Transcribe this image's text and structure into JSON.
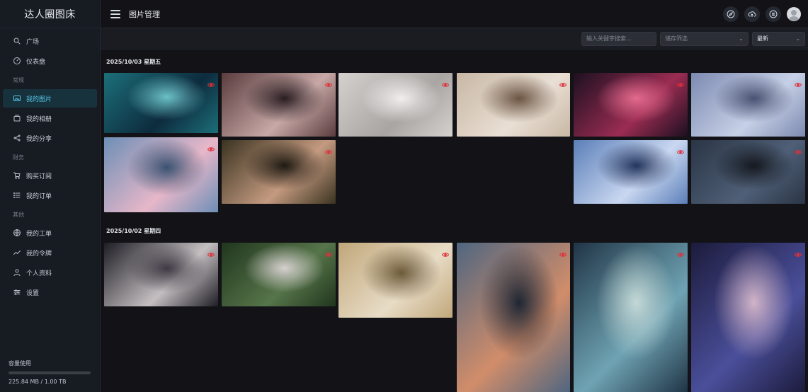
{
  "app": {
    "brand": "达人圈图床",
    "page_title": "图片管理"
  },
  "sidebar": {
    "items": [
      {
        "label": "广场",
        "icon": "search-icon"
      },
      {
        "label": "仪表盘",
        "icon": "dashboard-icon"
      }
    ],
    "sections": [
      {
        "title": "常规",
        "items": [
          {
            "label": "我的图片",
            "icon": "image-icon",
            "active": true
          },
          {
            "label": "我的相册",
            "icon": "album-icon"
          },
          {
            "label": "我的分享",
            "icon": "share-icon"
          }
        ]
      },
      {
        "title": "财务",
        "items": [
          {
            "label": "购买订阅",
            "icon": "cart-icon"
          },
          {
            "label": "我的订单",
            "icon": "list-icon"
          }
        ]
      },
      {
        "title": "其他",
        "items": [
          {
            "label": "我的工单",
            "icon": "globe-icon"
          },
          {
            "label": "我的令牌",
            "icon": "trend-icon"
          },
          {
            "label": "个人资料",
            "icon": "user-icon"
          },
          {
            "label": "设置",
            "icon": "settings-icon"
          }
        ]
      }
    ],
    "storage": {
      "title": "容量使用",
      "text": "225.84 MB / 1.00 TB",
      "fraction": 0.0002
    }
  },
  "topbar": {
    "icons": [
      "compass-icon",
      "cloud-upload-icon",
      "list-circle-icon",
      "avatar"
    ]
  },
  "filters": {
    "search_placeholder": "输入关键字搜索...",
    "storage_placeholder": "储存筛选",
    "sort_value": "最新"
  },
  "groups": [
    {
      "date": "2025/10/03 星期五",
      "images": [
        {
          "colors": [
            "#1c6f7a",
            "#0d2b3d",
            "#6bc0c7"
          ]
        },
        {
          "colors": [
            "#5b3c3e",
            "#c7a8a6",
            "#2a1e22"
          ]
        },
        {
          "colors": [
            "#d4d1cf",
            "#a9a5a2",
            "#f0eeee"
          ]
        },
        {
          "colors": [
            "#c8b7a4",
            "#e9dfd4",
            "#6b5443"
          ]
        },
        {
          "colors": [
            "#1c1020",
            "#9b2c52",
            "#e26a8d"
          ]
        },
        {
          "colors": [
            "#7d8ab1",
            "#c6d0e6",
            "#4a5173"
          ]
        },
        {
          "colors": [
            "#6c8fb6",
            "#e7b7c9",
            "#3a5372"
          ]
        },
        {
          "colors": [
            "#3a3320",
            "#c49a80",
            "#1e1a12"
          ]
        },
        {
          "colors": [
            "#5b7fb8",
            "#c9d7f1",
            "#24355d"
          ]
        },
        {
          "colors": [
            "#2a3545",
            "#4f5f77",
            "#15191f"
          ]
        }
      ]
    },
    {
      "date": "2025/10/02 星期四",
      "images": [
        {
          "colors": [
            "#1d1d24",
            "#c5bfc1",
            "#3e3a44"
          ]
        },
        {
          "colors": [
            "#21361d",
            "#56754a",
            "#d6d0cf"
          ]
        },
        {
          "colors": [
            "#c0a77a",
            "#e8dcc6",
            "#6d5a3a"
          ]
        },
        {
          "colors": [
            "#4f6680",
            "#d18d6a",
            "#1f2734"
          ]
        },
        {
          "colors": [
            "#203546",
            "#6fa3b3",
            "#c3d8d6"
          ]
        },
        {
          "colors": [
            "#1c1b3c",
            "#4a4f9a",
            "#d1b4c9"
          ]
        }
      ]
    }
  ]
}
